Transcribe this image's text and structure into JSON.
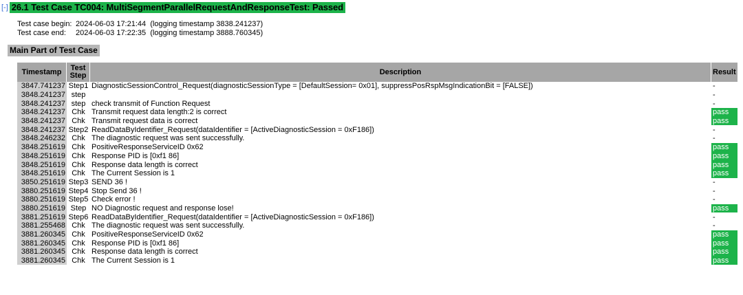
{
  "header": {
    "toggle": "[-]",
    "title": "26.1 Test Case TC004: MultiSegmentParallelRequestAndResponseTest: Passed"
  },
  "meta": {
    "begin_label": "Test case begin:",
    "begin_value": "2024-06-03 17:21:44  (logging timestamp 3838.241237)",
    "end_label": "Test case end:",
    "end_value": "2024-06-03 17:22:35  (logging timestamp 3888.760345)"
  },
  "section_title": "Main Part of Test Case",
  "table": {
    "headers": {
      "timestamp": "Timestamp",
      "test_step_line1": "Test",
      "test_step_line2": "Step",
      "description": "Description",
      "result": "Result"
    },
    "rows": [
      {
        "ts": "3847.741237",
        "step": "Step1",
        "desc": "DiagnosticSessionControl_Request(diagnosticSessionType = [DefaultSession= 0x01], suppressPosRspMsgIndicationBit = [FALSE])",
        "res": "-"
      },
      {
        "ts": "3848.241237",
        "step": "step",
        "desc": "",
        "res": "-"
      },
      {
        "ts": "3848.241237",
        "step": "step",
        "desc": "check transmit of Function Request",
        "res": "-"
      },
      {
        "ts": "3848.241237",
        "step": "Chk",
        "desc": "Transmit request data length:2 is correct",
        "res": "pass"
      },
      {
        "ts": "3848.241237",
        "step": "Chk",
        "desc": "Transmit request data is correct",
        "res": "pass"
      },
      {
        "ts": "3848.241237",
        "step": "Step2",
        "desc": "ReadDataByIdentifier_Request(dataIdentifier = [ActiveDiagnosticSession = 0xF186])",
        "res": "-"
      },
      {
        "ts": "3848.246232",
        "step": "Chk",
        "desc": "The diagnostic request was sent successfully.",
        "res": "-"
      },
      {
        "ts": "3848.251619",
        "step": "Chk",
        "desc": "PositiveResponseServiceID 0x62",
        "res": "pass"
      },
      {
        "ts": "3848.251619",
        "step": "Chk",
        "desc": "Response PID is [0xf1 86]",
        "res": "pass"
      },
      {
        "ts": "3848.251619",
        "step": "Chk",
        "desc": "Response data length is correct",
        "res": "pass"
      },
      {
        "ts": "3848.251619",
        "step": "Chk",
        "desc": "The Current Session is 1",
        "res": "pass"
      },
      {
        "ts": "3850.251619",
        "step": "Step3",
        "desc": "SEND 36 !",
        "res": "-"
      },
      {
        "ts": "3880.251619",
        "step": "Step4",
        "desc": "Stop Send 36 !",
        "res": "-"
      },
      {
        "ts": "3880.251619",
        "step": "Step5",
        "desc": "Check error !",
        "res": "-"
      },
      {
        "ts": "3880.251619",
        "step": "Step",
        "desc": "NO Diagnostic request and response lose!",
        "res": "pass"
      },
      {
        "ts": "3881.251619",
        "step": "Step6",
        "desc": "ReadDataByIdentifier_Request(dataIdentifier = [ActiveDiagnosticSession = 0xF186])",
        "res": "-"
      },
      {
        "ts": "3881.255468",
        "step": "Chk",
        "desc": "The diagnostic request was sent successfully.",
        "res": "-"
      },
      {
        "ts": "3881.260345",
        "step": "Chk",
        "desc": "PositiveResponseServiceID 0x62",
        "res": "pass"
      },
      {
        "ts": "3881.260345",
        "step": "Chk",
        "desc": "Response PID is [0xf1 86]",
        "res": "pass"
      },
      {
        "ts": "3881.260345",
        "step": "Chk",
        "desc": "Response data length is correct",
        "res": "pass"
      },
      {
        "ts": "3881.260345",
        "step": "Chk",
        "desc": "The Current Session is 1",
        "res": "pass"
      }
    ]
  },
  "colors": {
    "pass_bg": "#1db34a",
    "header_bg": "#a6a6a6",
    "timestamp_bg": "#cfcfcf",
    "toggle": "#3a6fd8"
  }
}
